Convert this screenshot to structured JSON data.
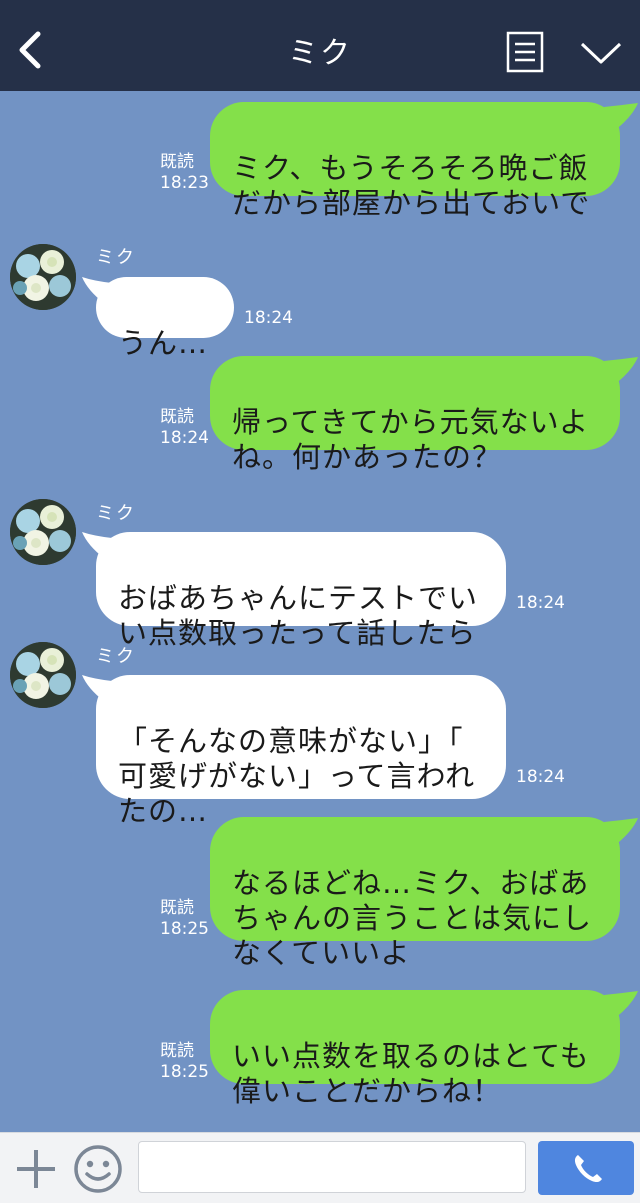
{
  "header": {
    "title": "ミク",
    "icons": [
      "back-arrow-icon",
      "memo-icon",
      "chevron-down-icon"
    ],
    "background": "#253048"
  },
  "chat": {
    "background": "#7293c4",
    "sent_bubble_color": "#84e04a",
    "received_bubble_color": "#ffffff",
    "messages": [
      {
        "side": "me",
        "text": "ミク、もうそろそろ晩ご飯\nだから部屋から出ておいで",
        "read": "既読",
        "time": "18:23"
      },
      {
        "side": "them",
        "sender": "ミク",
        "text": "うん…",
        "time": "18:24"
      },
      {
        "side": "me",
        "text": "帰ってきてから元気ないよ\nね。何かあったの？",
        "read": "既読",
        "time": "18:24"
      },
      {
        "side": "them",
        "sender": "ミク",
        "text": "おばあちゃんにテストでい\nい点数取ったって話したら",
        "time": "18:24"
      },
      {
        "side": "them",
        "sender": "ミク",
        "text": "「そんなの意味がない」「\n可愛げがない」って言われ\nたの…",
        "time": "18:24"
      },
      {
        "side": "me",
        "text": "なるほどね…ミク、おばあ\nちゃんの言うことは気にし\nなくていいよ",
        "read": "既読",
        "time": "18:25"
      },
      {
        "side": "me",
        "text": "いい点数を取るのはとても\n偉いことだからね！",
        "read": "既読",
        "time": "18:25"
      }
    ]
  },
  "footer": {
    "icons": [
      "plus-icon",
      "smile-icon",
      "phone-icon"
    ],
    "input_value": "",
    "input_placeholder": "",
    "call_button_color": "#4f86df"
  }
}
